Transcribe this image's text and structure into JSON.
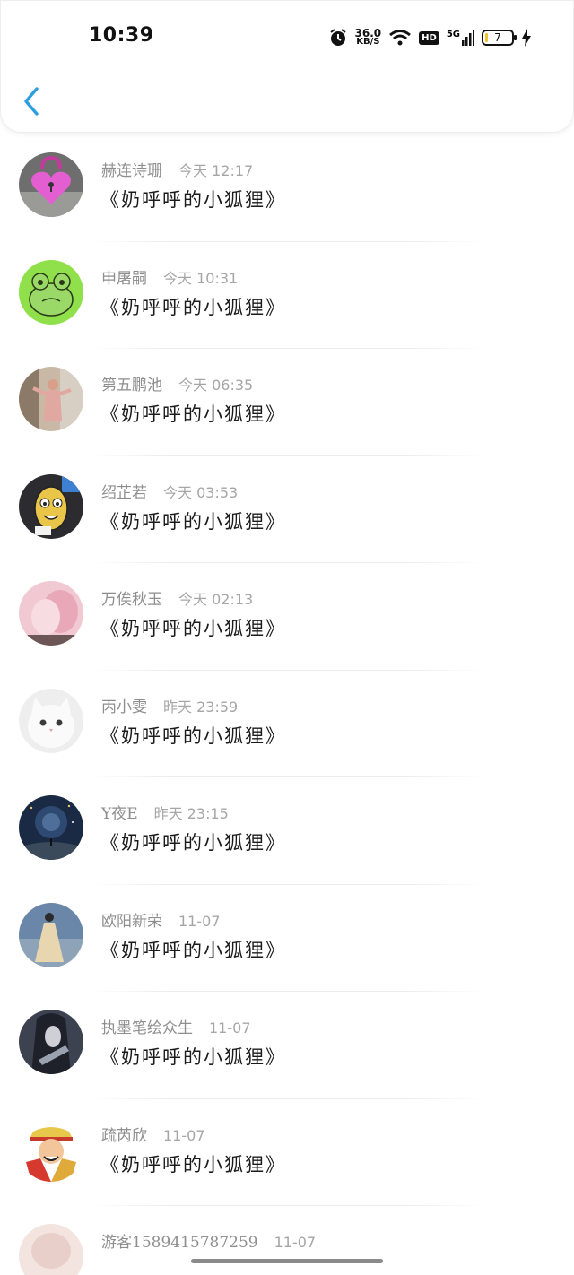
{
  "status_bar": {
    "time": "10:39",
    "net_speed": "36.0",
    "net_unit": "KB/S",
    "hd": "HD",
    "signal": "5G",
    "battery": "7"
  },
  "colors": {
    "accent": "#2a9fe0",
    "name_text": "#8e8e8e",
    "message_text": "#1b1b1b"
  },
  "messages": [
    {
      "name": "赫连诗珊",
      "time": "今天 12:17",
      "text": "《奶呼呼的小狐狸》",
      "avatar_icon": "pink-heart-lock-avatar"
    },
    {
      "name": "申屠嗣",
      "time": "今天 10:31",
      "text": "《奶呼呼的小狐狸》",
      "avatar_icon": "green-frog-avatar"
    },
    {
      "name": "第五鹏池",
      "time": "今天 06:35",
      "text": "《奶呼呼的小狐狸》",
      "avatar_icon": "person-photo-avatar"
    },
    {
      "name": "绍芷若",
      "time": "今天 03:53",
      "text": "《奶呼呼的小狐狸》",
      "avatar_icon": "cartoon-character-avatar"
    },
    {
      "name": "万俟秋玉",
      "time": "今天 02:13",
      "text": "《奶呼呼的小狐狸》",
      "avatar_icon": "pink-portrait-avatar"
    },
    {
      "name": "丙小雯",
      "time": "昨天 23:59",
      "text": "《奶呼呼的小狐狸》",
      "avatar_icon": "white-cat-avatar"
    },
    {
      "name": "Y夜E",
      "time": "昨天 23:15",
      "text": "《奶呼呼的小狐狸》",
      "avatar_icon": "night-sky-avatar"
    },
    {
      "name": "欧阳新荣",
      "time": "11-07",
      "text": "《奶呼呼的小狐狸》",
      "avatar_icon": "girl-dress-avatar"
    },
    {
      "name": "执墨笔绘众生",
      "time": "11-07",
      "text": "《奶呼呼的小狐狸》",
      "avatar_icon": "dark-character-avatar"
    },
    {
      "name": "疏芮欣",
      "time": "11-07",
      "text": "《奶呼呼的小狐狸》",
      "avatar_icon": "anime-pirate-avatar"
    },
    {
      "name": "游客15894157872​59",
      "time": "11-07",
      "text": "",
      "avatar_icon": "pastel-avatar"
    }
  ]
}
